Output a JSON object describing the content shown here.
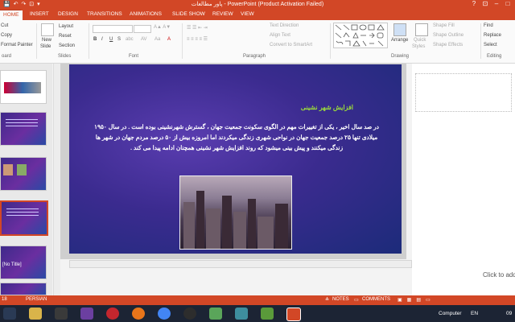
{
  "titlebar": {
    "title": "پاور مطالعات - PowerPoint (Product Activation Failed)",
    "quick_access": "💾 ↶ ↷ ⊡ ▾"
  },
  "tabs": [
    "HOME",
    "INSERT",
    "DESIGN",
    "TRANSITIONS",
    "ANIMATIONS",
    "SLIDE SHOW",
    "REVIEW",
    "VIEW"
  ],
  "ribbon": {
    "clipboard": {
      "cut": "Cut",
      "copy": "Copy",
      "format_painter": "Format Painter",
      "label": "oard"
    },
    "slides": {
      "new_slide": "New",
      "new_slide2": "Slide",
      "layout": "Layout",
      "reset": "Reset",
      "section": "Section",
      "label": "Slides"
    },
    "font": {
      "label": "Font",
      "bold": "B",
      "italic": "I",
      "underline": "U",
      "strike": "S",
      "abc": "abc",
      "av": "AV",
      "aa": "Aa",
      "font_color": "A"
    },
    "paragraph": {
      "text_direction": "Text Direction",
      "align_text": "Align Text",
      "convert_smartart": "Convert to SmartArt",
      "label": "Paragraph"
    },
    "drawing": {
      "arrange": "Arrange",
      "quick_styles": "Quick",
      "quick_styles2": "Styles",
      "shape_fill": "Shape Fill",
      "shape_outline": "Shape Outline",
      "shape_effects": "Shape Effects",
      "label": "Drawing"
    },
    "editing": {
      "find": "Find",
      "replace": "Replace",
      "select": "Select",
      "label": "Editing"
    }
  },
  "thumbs": {
    "no_title": "[No Title]"
  },
  "slide": {
    "title": "افزایش شهر نشینی",
    "body": "در صد سال اخیر ، یکی از تغییرات مهم در الگوی سکونت جمعیت جهان ، گسترش شهرنشینی بوده است . در سال ۱۹۵۰ میلادی تنها ۲۵ درصد جمعیت جهان در نواحی شهری زندگی میکردند اما امروزه بیش از ۵۰ درصد مردم جهان در شهر ها زندگی میکنند و پیش بینی میشود که روند افزایش شهر نشینی همچنان ادامه پیدا می کند ."
  },
  "notes_pane": {
    "placeholder": "Click to add"
  },
  "status": {
    "slide_num": "18",
    "language": "PERSIAN",
    "notes": "NOTES",
    "comments": "COMMENTS"
  },
  "taskbar": {
    "computer": "Computer",
    "lang": "EN",
    "time": "09"
  }
}
